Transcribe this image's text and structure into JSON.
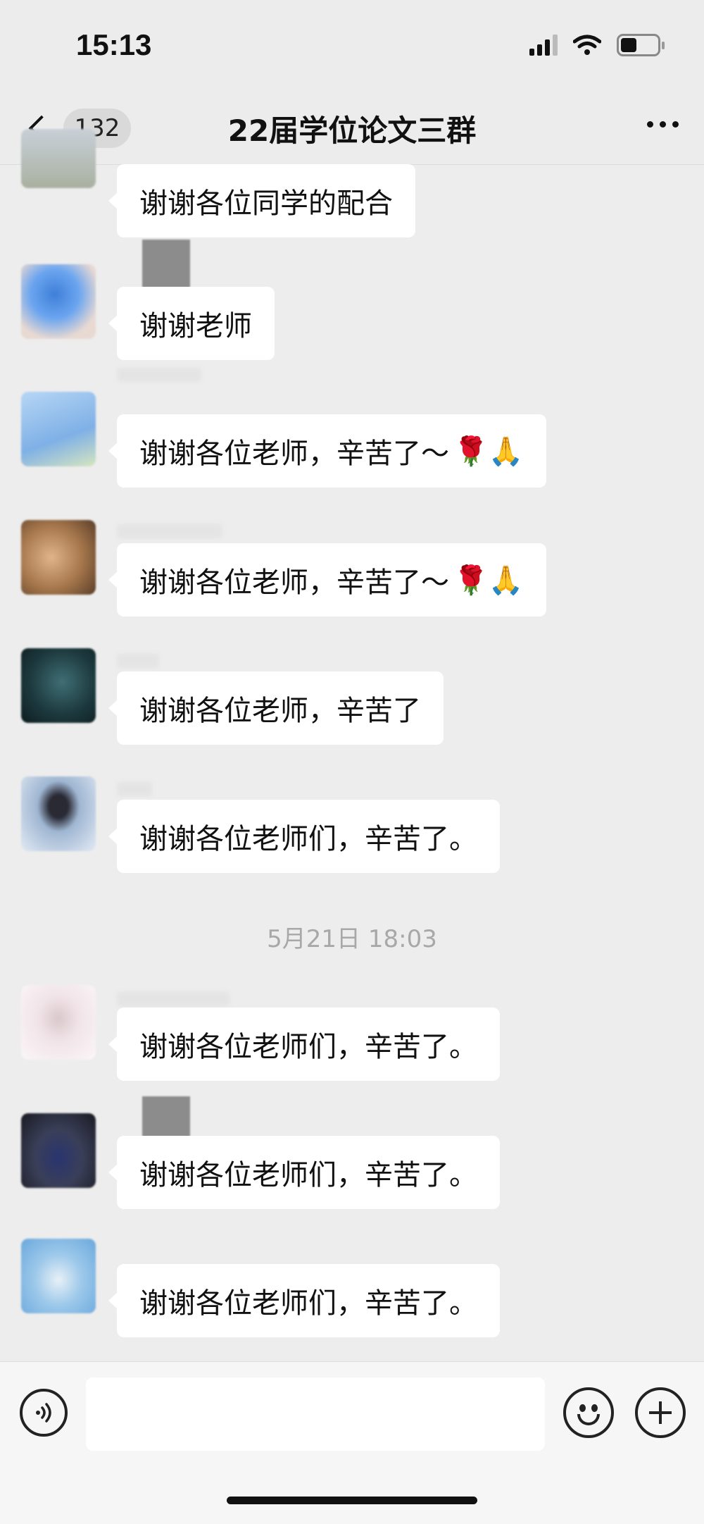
{
  "status_bar": {
    "time": "15:13"
  },
  "nav": {
    "unread_count": "132",
    "title": "22届学位论文三群"
  },
  "messages": [
    {
      "text": "谢谢各位同学的配合",
      "avatar_color": "#b9c3cf"
    },
    {
      "text": "谢谢老师",
      "avatar_color": "#5b8ed8"
    },
    {
      "text": "谢谢各位老师，辛苦了～",
      "emojis": "🌹🙏",
      "avatar_color": "#9fc4ee"
    },
    {
      "text": "谢谢各位老师，辛苦了～",
      "emojis": "🌹🙏",
      "avatar_color": "#a4754a"
    },
    {
      "text": "谢谢各位老师，辛苦了",
      "avatar_color": "#1d3a3f"
    },
    {
      "text": "谢谢各位老师们，辛苦了。",
      "avatar_color": "#b7c8dc"
    },
    {
      "text": "谢谢各位老师们，辛苦了。",
      "avatar_color": "#f2e6ea"
    },
    {
      "text": "谢谢各位老师们，辛苦了。",
      "avatar_color": "#3a3f58"
    },
    {
      "text": "谢谢各位老师们，辛苦了。",
      "avatar_color": "#7ab3de"
    }
  ],
  "timestamp": "5月21日 18:03",
  "input": {
    "placeholder": ""
  },
  "icons": {
    "back": "chevron-left-icon",
    "more": "more-dots-icon",
    "voice": "voice-icon",
    "emoji": "emoji-icon",
    "plus": "plus-icon"
  }
}
